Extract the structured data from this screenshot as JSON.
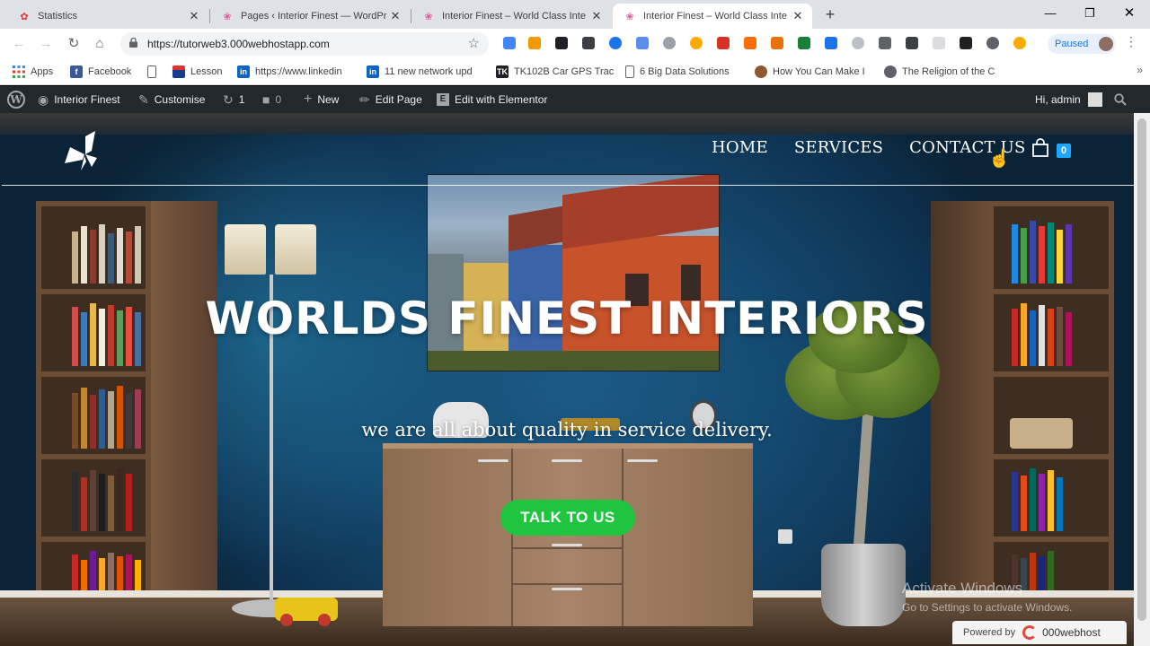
{
  "browser": {
    "tabs": [
      {
        "title": "Statistics",
        "active": false
      },
      {
        "title": "Pages ‹ Interior Finest — WordPr",
        "active": false
      },
      {
        "title": "Interior Finest – World Class Inte",
        "active": false
      },
      {
        "title": "Interior Finest – World Class Inte",
        "active": true
      }
    ],
    "new_tab": "+",
    "url": "https://tutorweb3.000webhostapp.com",
    "profile_status": "Paused",
    "bookmarks": [
      {
        "label": "Apps",
        "icon": "apps-grid-icon"
      },
      {
        "label": "Facebook",
        "icon": "facebook-icon"
      },
      {
        "label": "",
        "icon": "page-icon"
      },
      {
        "label": "Lesson",
        "icon": "lesson-icon"
      },
      {
        "label": "https://www.linkedin",
        "icon": "linkedin-icon"
      },
      {
        "label": "11 new network upd",
        "icon": "linkedin-icon"
      },
      {
        "label": "TK102B Car GPS Trac",
        "icon": "tk-icon"
      },
      {
        "label": "6 Big Data Solutions",
        "icon": "page-icon"
      },
      {
        "label": "How You Can Make I",
        "icon": "puzzle-icon"
      },
      {
        "label": "The Religion of the C",
        "icon": "globe-icon"
      }
    ]
  },
  "wp_admin_bar": {
    "site_name": "Interior Finest",
    "customise": "Customise",
    "updates_count": "1",
    "comments_count": "0",
    "new": "New",
    "edit_page": "Edit Page",
    "edit_with_elementor": "Edit with Elementor",
    "greeting": "Hi, admin"
  },
  "site": {
    "nav": [
      "HOME",
      "SERVICES",
      "CONTACT US"
    ],
    "cart_count": "0",
    "hero_title": "WORLDS FINEST INTERIORS",
    "hero_subtitle": "we are all about quality in service delivery.",
    "cta_label": "TALK TO US"
  },
  "overlay": {
    "activate_title": "Activate Windows",
    "activate_sub": "Go to Settings to activate Windows.",
    "powered_by": "Powered by",
    "host_brand": "000webhost"
  },
  "colors": {
    "cta_green": "#1fc53e",
    "wall_blue": "#144a70",
    "admin_bar": "#23282d",
    "cart_badge": "#1ea7fd"
  }
}
